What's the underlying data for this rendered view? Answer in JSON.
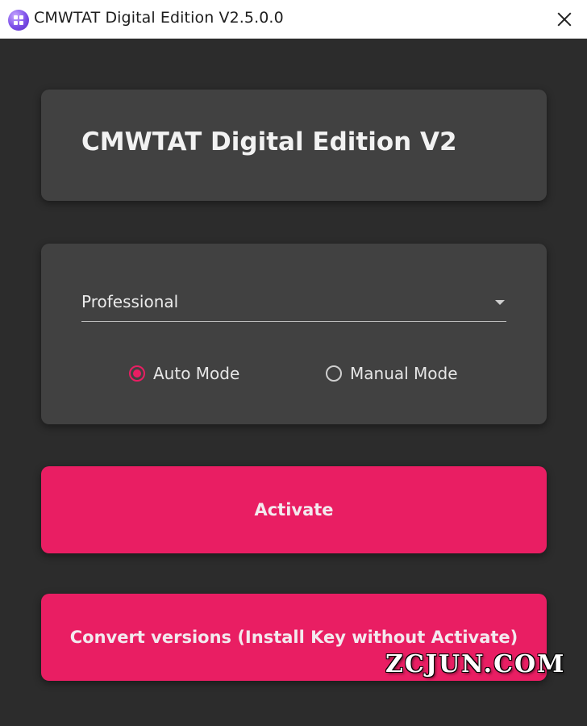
{
  "window": {
    "title": "CMWTAT Digital Edition V2.5.0.0",
    "app_icon": "windows-logo-icon",
    "close_icon": "close-icon"
  },
  "header": {
    "heading": "CMWTAT Digital Edition V2"
  },
  "options": {
    "edition_select": {
      "selected": "Professional",
      "icon": "chevron-down-icon"
    },
    "modes": [
      {
        "label": "Auto Mode",
        "checked": true
      },
      {
        "label": "Manual Mode",
        "checked": false
      }
    ]
  },
  "actions": {
    "activate_label": "Activate",
    "convert_label": "Convert versions (Install Key without Activate)"
  },
  "watermark": "ZCJUN.COM",
  "colors": {
    "accent": "#e91e63",
    "background": "#2c2c2c",
    "card": "#414141",
    "titlebar": "#ffffff"
  }
}
